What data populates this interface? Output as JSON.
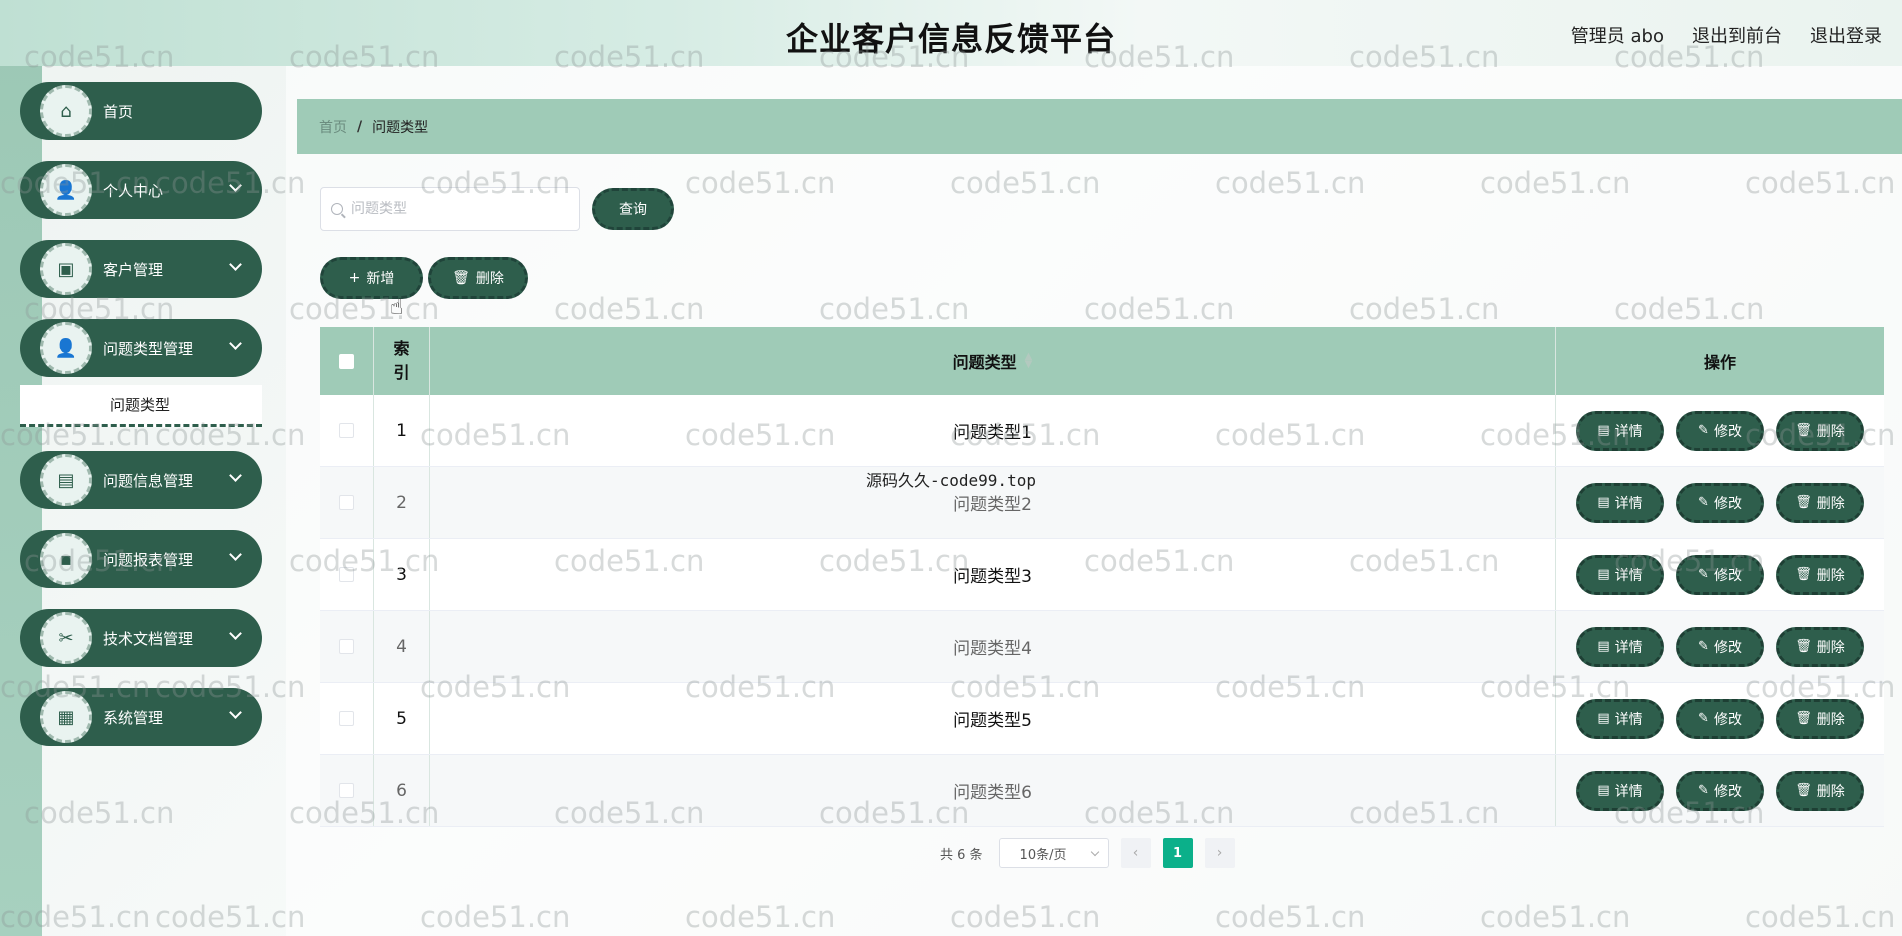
{
  "header": {
    "title": "企业客户信息反馈平台",
    "user": "管理员 abo",
    "front_link": "退出到前台",
    "logout": "退出登录"
  },
  "sidebar": {
    "items": [
      {
        "label": "首页",
        "icon": "home-icon",
        "glyph": "⌂"
      },
      {
        "label": "个人中心",
        "icon": "user-icon",
        "glyph": "👤"
      },
      {
        "label": "客户管理",
        "icon": "monitor-icon",
        "glyph": "▣"
      },
      {
        "label": "问题类型管理",
        "icon": "user-icon",
        "glyph": "👤"
      },
      {
        "label": "问题信息管理",
        "icon": "book-icon",
        "glyph": "▤"
      },
      {
        "label": "问题报表管理",
        "icon": "chat-icon",
        "glyph": "▪"
      },
      {
        "label": "技术文档管理",
        "icon": "ticket-icon",
        "glyph": "✂"
      },
      {
        "label": "系统管理",
        "icon": "grid-icon",
        "glyph": "▦"
      }
    ],
    "active_sub": "问题类型"
  },
  "breadcrumb": {
    "home": "首页",
    "separator": "/",
    "current": "问题类型"
  },
  "search": {
    "placeholder": "问题类型",
    "value": "",
    "button": "查询"
  },
  "toolbar": {
    "add": "新增",
    "delete": "删除"
  },
  "table": {
    "headers": {
      "index_line1": "索",
      "index_line2": "引",
      "type": "问题类型",
      "ops": "操作"
    },
    "rows": [
      {
        "index": "1",
        "type": "问题类型1"
      },
      {
        "index": "2",
        "type": "问题类型2"
      },
      {
        "index": "3",
        "type": "问题类型3"
      },
      {
        "index": "4",
        "type": "问题类型4"
      },
      {
        "index": "5",
        "type": "问题类型5"
      },
      {
        "index": "6",
        "type": "问题类型6"
      }
    ],
    "ops": {
      "detail": "详情",
      "edit": "修改",
      "delete": "删除"
    }
  },
  "overlay": "源码久久-code99.top",
  "pagination": {
    "total": "共 6 条",
    "page_size": "10条/页",
    "current": "1"
  },
  "watermark": "code51.cn",
  "colors": {
    "primary": "#2e5e4c",
    "header_row": "#9fcbb7",
    "page_active": "#0bb08a"
  }
}
